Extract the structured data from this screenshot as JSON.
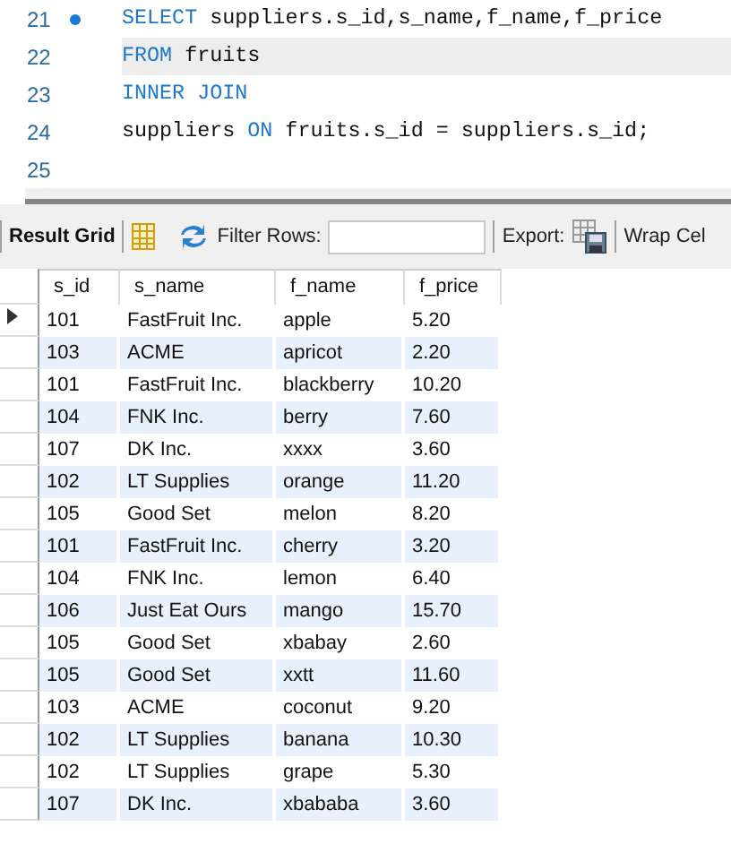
{
  "editor": {
    "lines": [
      {
        "number": "21",
        "marker": true,
        "current": false,
        "tokens": [
          {
            "kind": "keyword",
            "text": "SELECT"
          },
          {
            "kind": "text",
            "text": " suppliers.s_id,s_name,f_name,f_price"
          }
        ]
      },
      {
        "number": "22",
        "marker": false,
        "current": true,
        "tokens": [
          {
            "kind": "keyword",
            "text": "FROM"
          },
          {
            "kind": "text",
            "text": " fruits"
          }
        ]
      },
      {
        "number": "23",
        "marker": false,
        "current": false,
        "tokens": [
          {
            "kind": "keyword",
            "text": "INNER JOIN"
          }
        ]
      },
      {
        "number": "24",
        "marker": false,
        "current": false,
        "tokens": [
          {
            "kind": "text",
            "text": "suppliers "
          },
          {
            "kind": "keyword",
            "text": "ON"
          },
          {
            "kind": "text",
            "text": " fruits.s_id = suppliers.s_id;"
          }
        ]
      },
      {
        "number": "25",
        "marker": false,
        "current": false
      }
    ]
  },
  "toolbar": {
    "result_grid": "Result Grid",
    "filter_label": "Filter Rows:",
    "export_label": "Export:",
    "wrap_label": "Wrap Cel"
  },
  "table": {
    "columns": [
      "s_id",
      "s_name",
      "f_name",
      "f_price"
    ],
    "rows": [
      {
        "current": true,
        "cells": [
          "101",
          "FastFruit Inc.",
          "apple",
          "5.20"
        ]
      },
      {
        "current": false,
        "cells": [
          "103",
          "ACME",
          "apricot",
          "2.20"
        ]
      },
      {
        "current": false,
        "cells": [
          "101",
          "FastFruit Inc.",
          "blackberry",
          "10.20"
        ]
      },
      {
        "current": false,
        "cells": [
          "104",
          "FNK Inc.",
          "berry",
          "7.60"
        ]
      },
      {
        "current": false,
        "cells": [
          "107",
          "DK Inc.",
          "xxxx",
          "3.60"
        ]
      },
      {
        "current": false,
        "cells": [
          "102",
          "LT Supplies",
          "orange",
          "11.20"
        ]
      },
      {
        "current": false,
        "cells": [
          "105",
          "Good Set",
          "melon",
          "8.20"
        ]
      },
      {
        "current": false,
        "cells": [
          "101",
          "FastFruit Inc.",
          "cherry",
          "3.20"
        ]
      },
      {
        "current": false,
        "cells": [
          "104",
          "FNK Inc.",
          "lemon",
          "6.40"
        ]
      },
      {
        "current": false,
        "cells": [
          "106",
          "Just Eat Ours",
          "mango",
          "15.70"
        ]
      },
      {
        "current": false,
        "cells": [
          "105",
          "Good Set",
          "xbabay",
          "2.60"
        ]
      },
      {
        "current": false,
        "cells": [
          "105",
          "Good Set",
          "xxtt",
          "11.60"
        ]
      },
      {
        "current": false,
        "cells": [
          "103",
          "ACME",
          "coconut",
          "9.20"
        ]
      },
      {
        "current": false,
        "cells": [
          "102",
          "LT Supplies",
          "banana",
          "10.30"
        ]
      },
      {
        "current": false,
        "cells": [
          "102",
          "LT Supplies",
          "grape",
          "5.30"
        ]
      },
      {
        "current": false,
        "cells": [
          "107",
          "DK Inc.",
          "xbababa",
          "3.60"
        ]
      }
    ]
  }
}
